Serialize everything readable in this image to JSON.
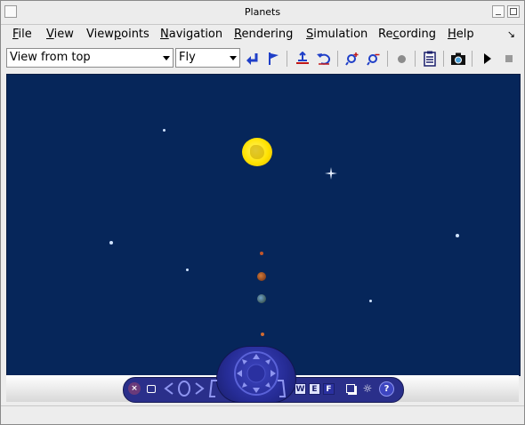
{
  "window": {
    "title": "Planets"
  },
  "menubar": {
    "items": [
      {
        "label": "File",
        "hotkey": "F",
        "rest": "ile"
      },
      {
        "label": "View",
        "hotkey": "V",
        "rest": "iew"
      },
      {
        "label": "Viewpoints",
        "pre": "View",
        "hotkey": "p",
        "rest": "oints"
      },
      {
        "label": "Navigation",
        "hotkey": "N",
        "rest": "avigation"
      },
      {
        "label": "Rendering",
        "hotkey": "R",
        "rest": "endering"
      },
      {
        "label": "Simulation",
        "hotkey": "S",
        "rest": "imulation"
      },
      {
        "label": "Recording",
        "pre": "Re",
        "hotkey": "c",
        "rest": "ording"
      },
      {
        "label": "Help",
        "hotkey": "H",
        "rest": "elp"
      }
    ]
  },
  "toolbar": {
    "viewpoint_select": "View from top",
    "navigation_mode_select": "Fly"
  },
  "colors": {
    "scene_background": "#06265a",
    "sun": "#ffe200",
    "toolbar_blue": "#1f3fc8",
    "dock": "#2a2f8a"
  },
  "icons": [
    "back-arrow-icon",
    "flag-icon",
    "viewpoint-icon",
    "reset-icon",
    "zoom-in-icon",
    "zoom-out-icon",
    "record-dot-icon",
    "list-icon",
    "camera-icon",
    "play-icon",
    "stop-icon"
  ],
  "nav_dock": {
    "w_label": "W",
    "e_label": "E",
    "f_label": "F",
    "help_label": "?"
  }
}
